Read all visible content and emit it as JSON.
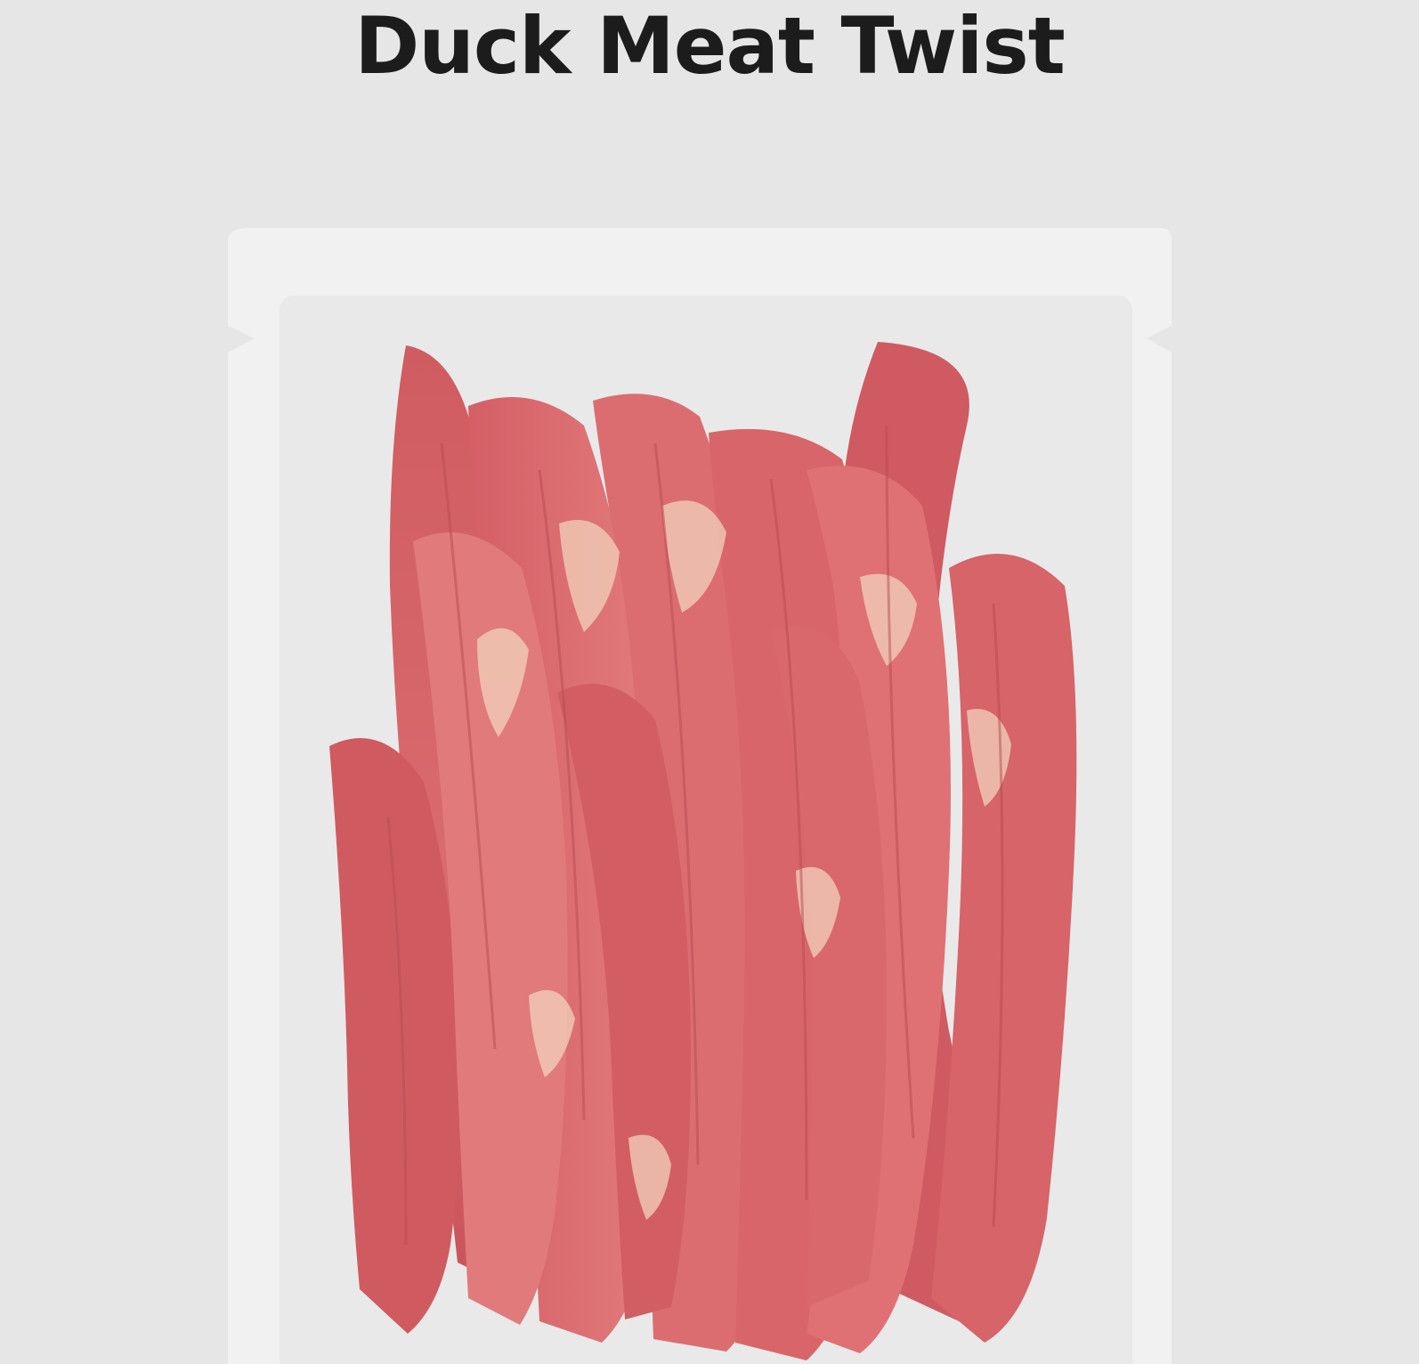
{
  "page": {
    "title": "Duck Meat Twist"
  },
  "product": {
    "image_subject": "duck-meat-strips",
    "colors": {
      "background": "#e6e6e6",
      "pouch": "#f1f1f1",
      "window": "#e9e9e9",
      "meat": "#d8636a"
    }
  }
}
